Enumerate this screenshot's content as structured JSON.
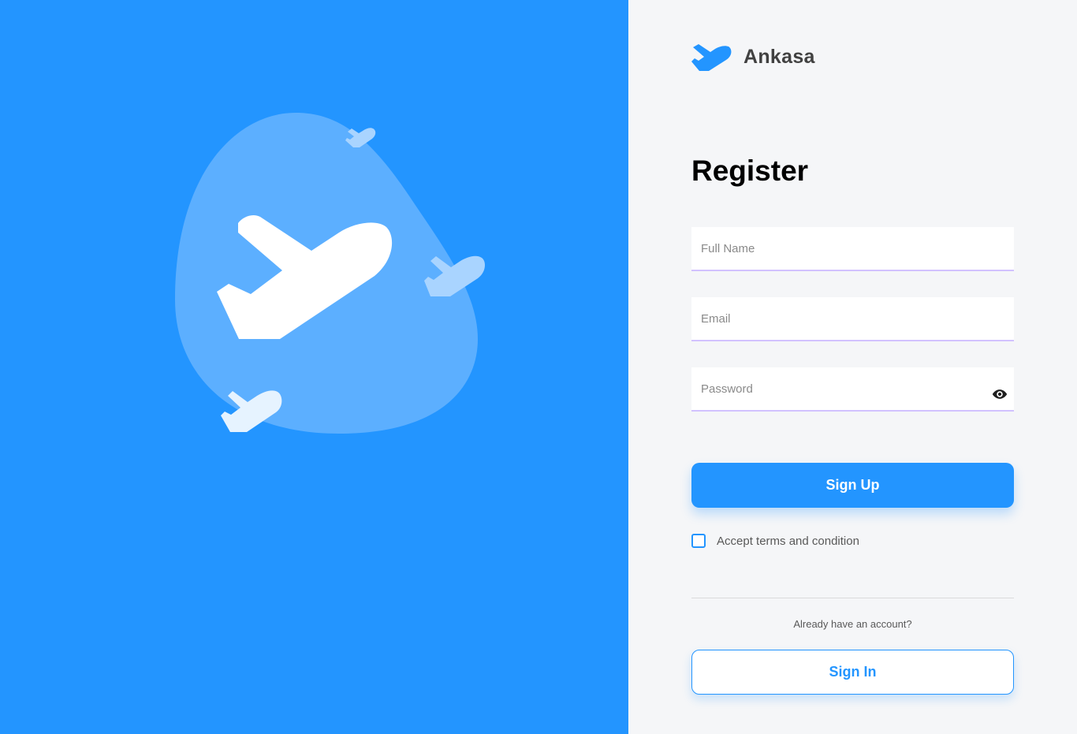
{
  "brand": {
    "name": "Ankasa",
    "icon": "plane-logo-icon"
  },
  "hero": {
    "illustration": "planes-blob-illustration",
    "colors": {
      "background": "#2395FF",
      "blob": "#5CAFFF"
    }
  },
  "form": {
    "title": "Register",
    "fields": {
      "fullname": {
        "placeholder": "Full Name",
        "value": ""
      },
      "email": {
        "placeholder": "Email",
        "value": ""
      },
      "password": {
        "placeholder": "Password",
        "value": "",
        "toggle_icon": "eye-icon"
      }
    },
    "signup_label": "Sign Up",
    "terms_label": "Accept terms and condition",
    "terms_checked": false,
    "already_text": "Already have an account?",
    "signin_label": "Sign In"
  },
  "colors": {
    "accent": "#2395FF",
    "panel_bg": "#F5F6F8",
    "field_border": "#D2C2FF"
  }
}
